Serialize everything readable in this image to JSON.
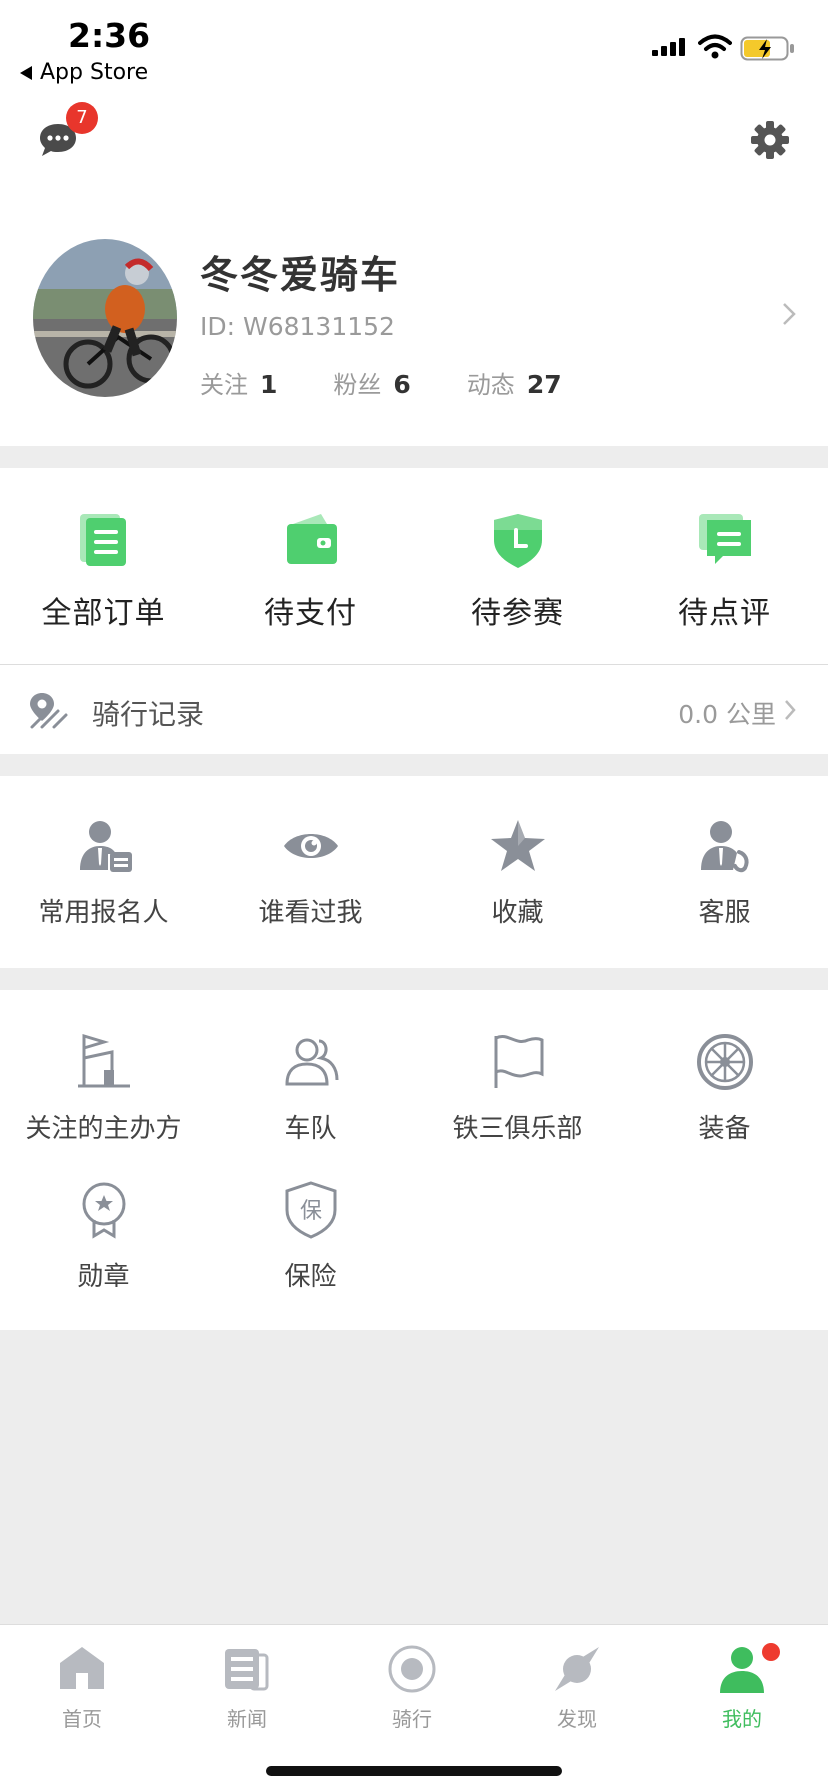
{
  "status_bar": {
    "time": "2:36",
    "back_label": "App Store"
  },
  "header": {
    "unread_count": "7"
  },
  "profile": {
    "nickname": "冬冬爱骑车",
    "id_text": "ID: W68131152",
    "following_label": "关注",
    "following_count": "1",
    "fans_label": "粉丝",
    "fans_count": "6",
    "posts_label": "动态",
    "posts_count": "27"
  },
  "orders": [
    {
      "label": "全部订单",
      "icon": "order-list-icon"
    },
    {
      "label": "待支付",
      "icon": "wallet-icon"
    },
    {
      "label": "待参赛",
      "icon": "shield-clock-icon"
    },
    {
      "label": "待点评",
      "icon": "comment-icon"
    }
  ],
  "ride_record": {
    "label": "骑行记录",
    "value": "0.0 公里"
  },
  "services": [
    {
      "label": "常用报名人",
      "icon": "user-card-icon"
    },
    {
      "label": "谁看过我",
      "icon": "eye-icon"
    },
    {
      "label": "收藏",
      "icon": "star-icon"
    },
    {
      "label": "客服",
      "icon": "customer-service-icon"
    }
  ],
  "more": [
    {
      "label": "关注的主办方",
      "icon": "organizer-flag-icon"
    },
    {
      "label": "车队",
      "icon": "team-icon"
    },
    {
      "label": "铁三俱乐部",
      "icon": "flag-icon"
    },
    {
      "label": "装备",
      "icon": "wheel-icon"
    },
    {
      "label": "勋章",
      "icon": "medal-icon"
    },
    {
      "label": "保险",
      "icon": "insurance-shield-icon"
    }
  ],
  "tabbar": [
    {
      "label": "首页",
      "icon": "home-icon"
    },
    {
      "label": "新闻",
      "icon": "news-icon"
    },
    {
      "label": "骑行",
      "icon": "ride-icon"
    },
    {
      "label": "发现",
      "icon": "discover-icon"
    },
    {
      "label": "我的",
      "icon": "me-icon"
    }
  ],
  "colors": {
    "accent": "#3fbd5e",
    "badge": "#e8362c",
    "icon_gray": "#8a8f98",
    "band": "#ededed"
  }
}
